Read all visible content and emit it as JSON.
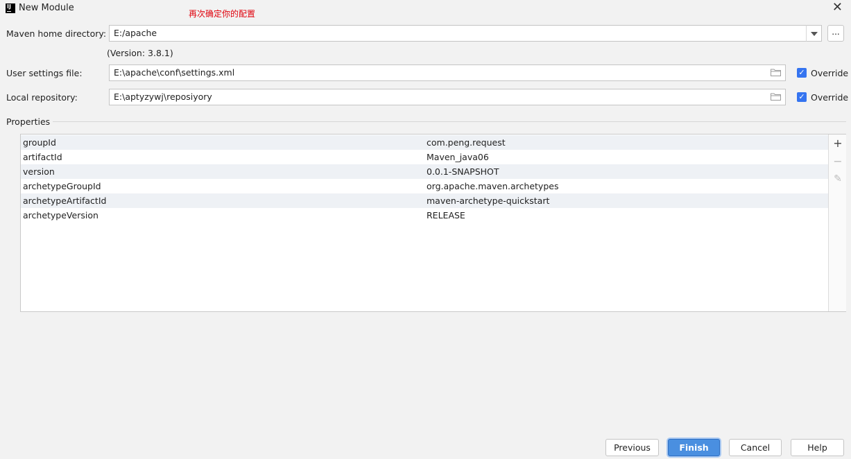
{
  "window": {
    "title": "New Module",
    "annotation": "再次确定你的配置"
  },
  "maven_home": {
    "label": "Maven home directory:",
    "value": "E:/apache",
    "browse_label": "...",
    "version": "(Version: 3.8.1)"
  },
  "user_settings": {
    "label": "User settings file:",
    "value": "E:\\apache\\conf\\settings.xml",
    "override_label": "Override",
    "override_checked": true
  },
  "local_repo": {
    "label": "Local repository:",
    "value": "E:\\aptyzywj\\reposiyory",
    "override_label": "Override",
    "override_checked": true
  },
  "properties": {
    "label": "Properties",
    "rows": [
      {
        "key": "groupId",
        "value": "com.peng.request"
      },
      {
        "key": "artifactId",
        "value": "Maven_java06"
      },
      {
        "key": "version",
        "value": "0.0.1-SNAPSHOT"
      },
      {
        "key": "archetypeGroupId",
        "value": "org.apache.maven.archetypes"
      },
      {
        "key": "archetypeArtifactId",
        "value": "maven-archetype-quickstart"
      },
      {
        "key": "archetypeVersion",
        "value": "RELEASE"
      }
    ],
    "tools": {
      "add": "+",
      "remove": "−",
      "edit": "✎"
    }
  },
  "buttons": {
    "previous": "Previous",
    "finish": "Finish",
    "cancel": "Cancel",
    "help": "Help"
  },
  "colors": {
    "accent": "#3574f0",
    "annotation": "#e0000b"
  }
}
